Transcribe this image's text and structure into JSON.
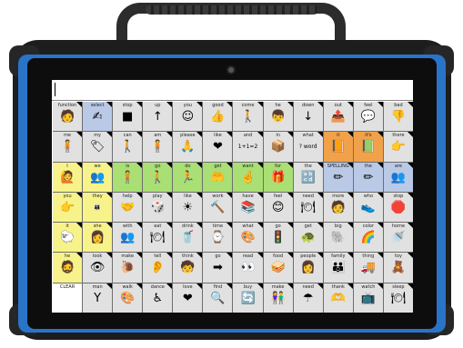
{
  "device": {
    "name": "AAC speech tablet"
  },
  "message_bar": {
    "text": ""
  },
  "grid": [
    [
      {
        "label": "function",
        "color": "gr",
        "icon": "🧑"
      },
      {
        "label": "select",
        "color": "b",
        "icon": "✍"
      },
      {
        "label": "stop",
        "color": "gr",
        "icon": "■"
      },
      {
        "label": "up",
        "color": "gr",
        "icon": "↑"
      },
      {
        "label": "you",
        "color": "gr",
        "icon": "☺"
      },
      {
        "label": "good",
        "color": "gr",
        "icon": "👍"
      },
      {
        "label": "come",
        "color": "gr",
        "icon": "🚶"
      },
      {
        "label": "he",
        "color": "gr",
        "icon": "👦"
      },
      {
        "label": "down",
        "color": "gr",
        "icon": "↓"
      },
      {
        "label": "out",
        "color": "gr",
        "icon": "📤"
      },
      {
        "label": "feel",
        "color": "gr",
        "icon": "💬"
      },
      {
        "label": "bad",
        "color": "gr",
        "icon": "👎"
      }
    ],
    [
      {
        "label": "me",
        "color": "gr",
        "icon": "🧍"
      },
      {
        "label": "my",
        "color": "gr",
        "icon": "🏷"
      },
      {
        "label": "can",
        "color": "gr",
        "icon": "🚶"
      },
      {
        "label": "am",
        "color": "gr",
        "icon": "🧍"
      },
      {
        "label": "please",
        "color": "gr",
        "icon": "🙏"
      },
      {
        "label": "like",
        "color": "gr",
        "icon": "❤"
      },
      {
        "label": "and",
        "color": "gr",
        "icon": "1+1=2"
      },
      {
        "label": "in",
        "color": "gr",
        "icon": "📦"
      },
      {
        "label": "what",
        "color": "gr",
        "icon": "? word"
      },
      {
        "label": "it",
        "color": "o",
        "icon": "📙"
      },
      {
        "label": "it's",
        "color": "o",
        "icon": "📗"
      },
      {
        "label": "there",
        "color": "gr",
        "icon": "👉"
      }
    ],
    [
      {
        "label": "I",
        "color": "y",
        "icon": "🙋"
      },
      {
        "label": "we",
        "color": "y",
        "icon": "👥"
      },
      {
        "label": "is",
        "color": "g",
        "icon": "🧍"
      },
      {
        "label": "go",
        "color": "g",
        "icon": "🚶"
      },
      {
        "label": "do",
        "color": "g",
        "icon": "🏃"
      },
      {
        "label": "get",
        "color": "g",
        "icon": "🤲"
      },
      {
        "label": "want",
        "color": "g",
        "icon": "🤞"
      },
      {
        "label": "for",
        "color": "g",
        "icon": "🎁"
      },
      {
        "label": "the",
        "color": "gr",
        "icon": "🔡"
      },
      {
        "label": "SPELLING",
        "color": "b",
        "icon": "✏"
      },
      {
        "label": "the",
        "color": "b",
        "icon": "✏"
      },
      {
        "label": "are",
        "color": "b",
        "icon": "👥"
      }
    ],
    [
      {
        "label": "you",
        "color": "y",
        "icon": "👉"
      },
      {
        "label": "they",
        "color": "y",
        "icon": "👨‍👩‍👧"
      },
      {
        "label": "help",
        "color": "gr",
        "icon": "🤝"
      },
      {
        "label": "play",
        "color": "gr",
        "icon": "🎲"
      },
      {
        "label": "like",
        "color": "gr",
        "icon": "☀"
      },
      {
        "label": "work",
        "color": "gr",
        "icon": "🔨"
      },
      {
        "label": "have",
        "color": "gr",
        "icon": "📚"
      },
      {
        "label": "feel",
        "color": "gr",
        "icon": "😊"
      },
      {
        "label": "need",
        "color": "gr",
        "icon": "🍽"
      },
      {
        "label": "more",
        "color": "gr",
        "icon": "🧑"
      },
      {
        "label": "who",
        "color": "gr",
        "icon": "👟"
      },
      {
        "label": "stop",
        "color": "gr",
        "icon": "🛑"
      }
    ],
    [
      {
        "label": "it",
        "color": "y",
        "icon": "🐑"
      },
      {
        "label": "she",
        "color": "y",
        "icon": "👩"
      },
      {
        "label": "with",
        "color": "gr",
        "icon": "👥"
      },
      {
        "label": "eat",
        "color": "gr",
        "icon": "🍽"
      },
      {
        "label": "drink",
        "color": "gr",
        "icon": "🥤"
      },
      {
        "label": "time",
        "color": "gr",
        "icon": "⌚"
      },
      {
        "label": "what",
        "color": "gr",
        "icon": "🎨"
      },
      {
        "label": "go",
        "color": "gr",
        "icon": "🚦"
      },
      {
        "label": "get",
        "color": "gr",
        "icon": "🐢"
      },
      {
        "label": "big",
        "color": "gr",
        "icon": "🐘"
      },
      {
        "label": "color",
        "color": "gr",
        "icon": "🌈"
      },
      {
        "label": "home",
        "color": "gr",
        "icon": "🚿"
      }
    ],
    [
      {
        "label": "he",
        "color": "y",
        "icon": "🧔"
      },
      {
        "label": "look",
        "color": "gr",
        "icon": "👁"
      },
      {
        "label": "make",
        "color": "gr",
        "icon": "🐌"
      },
      {
        "label": "tell",
        "color": "gr",
        "icon": "👂"
      },
      {
        "label": "think",
        "color": "gr",
        "icon": "🧒"
      },
      {
        "label": "go",
        "color": "gr",
        "icon": "➡"
      },
      {
        "label": "read",
        "color": "gr",
        "icon": "👀"
      },
      {
        "label": "food",
        "color": "gr",
        "icon": "🥪"
      },
      {
        "label": "people",
        "color": "gr",
        "icon": "👩"
      },
      {
        "label": "family",
        "color": "gr",
        "icon": "👪"
      },
      {
        "label": "thing",
        "color": "gr",
        "icon": "🚚"
      },
      {
        "label": "toy",
        "color": "gr",
        "icon": "🧸"
      }
    ],
    [
      {
        "label": "CLEAR",
        "color": "w",
        "icon": ""
      },
      {
        "label": "man",
        "color": "gr",
        "icon": "Y"
      },
      {
        "label": "walk",
        "color": "gr",
        "icon": "🎨"
      },
      {
        "label": "dance",
        "color": "gr",
        "icon": "♿"
      },
      {
        "label": "love",
        "color": "gr",
        "icon": "❤"
      },
      {
        "label": "find",
        "color": "gr",
        "icon": "🔍"
      },
      {
        "label": "buy",
        "color": "gr",
        "icon": "🔄"
      },
      {
        "label": "make",
        "color": "gr",
        "icon": "👫"
      },
      {
        "label": "need",
        "color": "gr",
        "icon": "☂"
      },
      {
        "label": "thank",
        "color": "gr",
        "icon": "🫶"
      },
      {
        "label": "watch",
        "color": "gr",
        "icon": "📺"
      },
      {
        "label": "sleep",
        "color": "gr",
        "icon": "🍽"
      }
    ]
  ]
}
